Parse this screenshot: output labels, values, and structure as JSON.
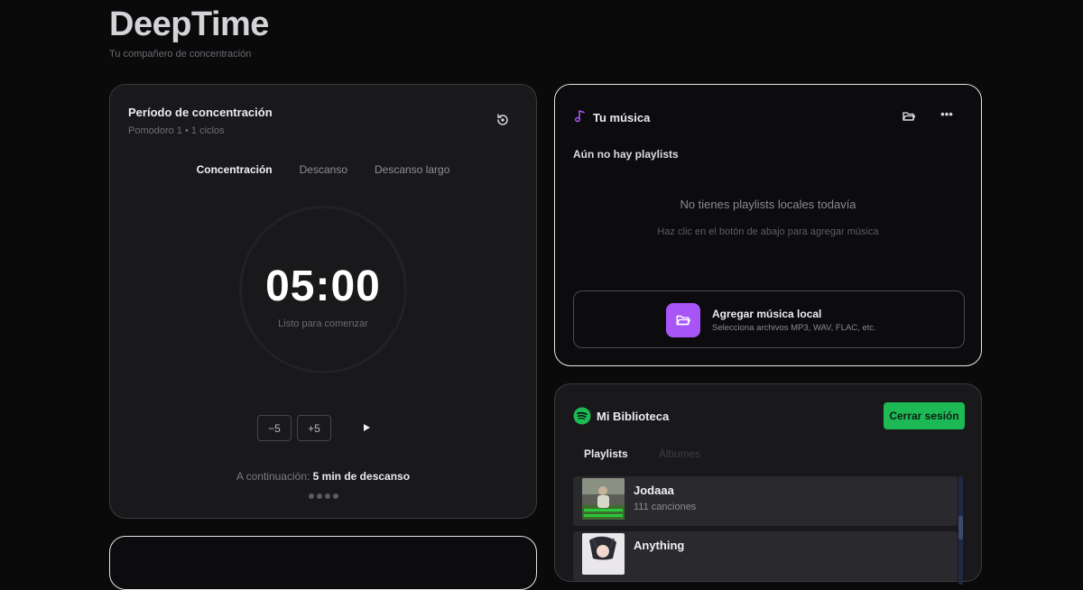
{
  "app": {
    "title": "DeepTime",
    "subtitle": "Tu compañero de concentración"
  },
  "timer": {
    "title": "Período de concentración",
    "subtitle": "Pomodoro 1 • 1 ciclos",
    "modes": [
      "Concentración",
      "Descanso",
      "Descanso largo"
    ],
    "active_mode": "Concentración",
    "time": "05:00",
    "status": "Listo para comenzar",
    "minus_label": "−5",
    "plus_label": "+5",
    "next_prefix": "A continuación: ",
    "next_value": "5 min de descanso",
    "cycle_dots": 4
  },
  "music": {
    "title": "Tu música",
    "no_playlists": "Aún no hay playlists",
    "empty_title": "No tienes playlists locales todavía",
    "empty_hint": "Haz clic en el botón de abajo para agregar música",
    "add_title": "Agregar música local",
    "add_subtitle": "Selecciona archivos MP3, WAV, FLAC, etc."
  },
  "library": {
    "title": "Mi Biblioteca",
    "logout_label": "Cerrar sesión",
    "tabs": [
      "Playlists",
      "Álbumes"
    ],
    "active_tab": "Playlists",
    "items": [
      {
        "name": "Jodaaa",
        "count": "111 canciones"
      },
      {
        "name": "Anything",
        "count": ""
      }
    ]
  },
  "colors": {
    "accent_purple": "#a855f7",
    "spotify_green": "#1db954",
    "background": "#0a0a0b"
  }
}
